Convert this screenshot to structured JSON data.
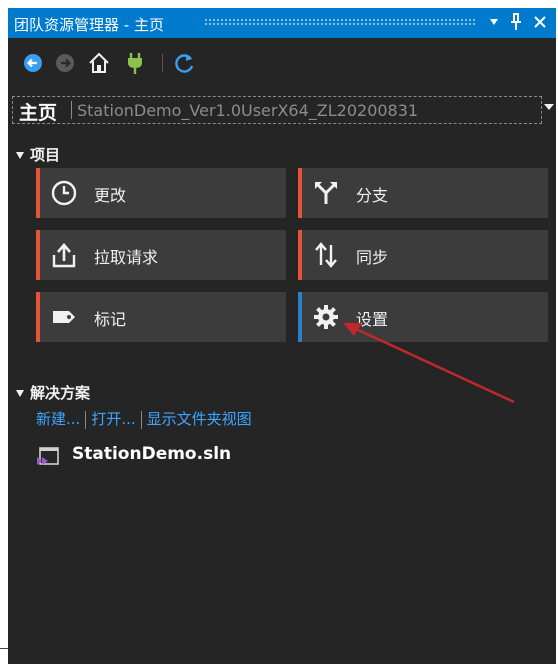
{
  "window": {
    "title": "团队资源管理器 - 主页",
    "dropdown_icon": "chevron-down-icon",
    "pin_icon": "pin-icon",
    "close_icon": "close-icon"
  },
  "toolbar": {
    "buttons": [
      "back-icon",
      "forward-icon",
      "home-icon",
      "connect-icon",
      "refresh-icon"
    ]
  },
  "selector": {
    "home_label": "主页",
    "context": "StationDemo_Ver1.0UserX64_ZL20200831"
  },
  "project": {
    "header": "项目",
    "tiles": [
      {
        "label": "更改",
        "icon": "clock-icon",
        "accent": "#e55339"
      },
      {
        "label": "分支",
        "icon": "branch-icon",
        "accent": "#e55339"
      },
      {
        "label": "拉取请求",
        "icon": "pull-request-icon",
        "accent": "#e55339"
      },
      {
        "label": "同步",
        "icon": "sync-icon",
        "accent": "#e55339"
      },
      {
        "label": "标记",
        "icon": "tag-icon",
        "accent": "#e55339"
      },
      {
        "label": "设置",
        "icon": "gear-icon",
        "accent": "#2d7fc8"
      }
    ]
  },
  "solutions": {
    "header": "解决方案",
    "links": [
      "新建...",
      "打开...",
      "显示文件夹视图"
    ],
    "items": [
      {
        "label": "StationDemo.sln",
        "icon": "solution-file-icon"
      }
    ]
  },
  "colors": {
    "title_bar": "#007acc",
    "panel_bg": "#252526",
    "tile_bg": "#3c3c3c",
    "link": "#3ea6ff",
    "annotation_arrow": "#c0282d"
  }
}
